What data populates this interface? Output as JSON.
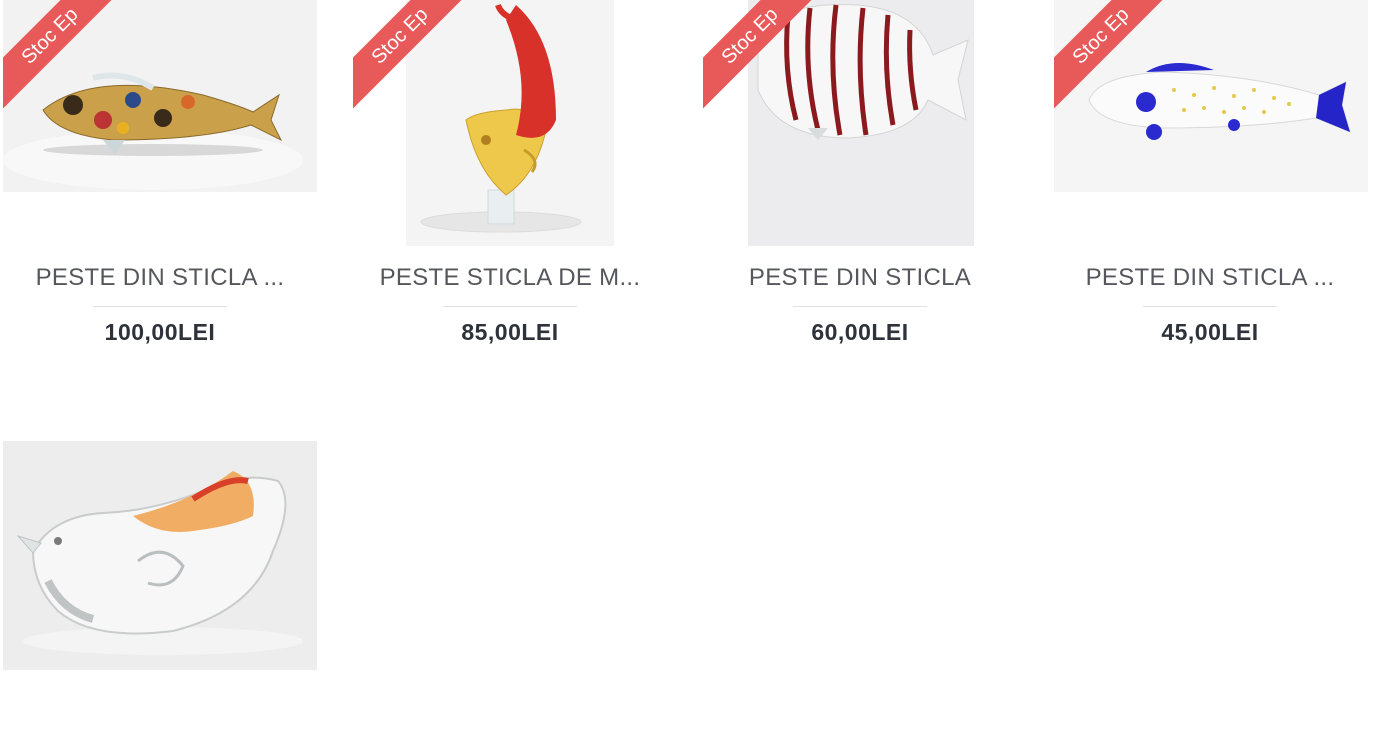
{
  "ribbon_color": "#e8595a",
  "products": [
    {
      "title": "PESTE DIN STICLA ...",
      "price": "100,00LEI",
      "badge": "Stoc Ep",
      "image": "multicolor-glass-fish"
    },
    {
      "title": "PESTE STICLA DE M...",
      "price": "85,00LEI",
      "badge": "Stoc Ep",
      "image": "red-yellow-glass-angelfish"
    },
    {
      "title": "PESTE DIN STICLA",
      "price": "60,00LEI",
      "badge": "Stoc Ep",
      "image": "striped-white-glass-fish"
    },
    {
      "title": "PESTE DIN STICLA ...",
      "price": "45,00LEI",
      "badge": "Stoc Ep",
      "image": "white-blue-glass-fish"
    },
    {
      "title": "",
      "price": "",
      "badge": "",
      "image": "clear-amber-glass-bird"
    }
  ]
}
